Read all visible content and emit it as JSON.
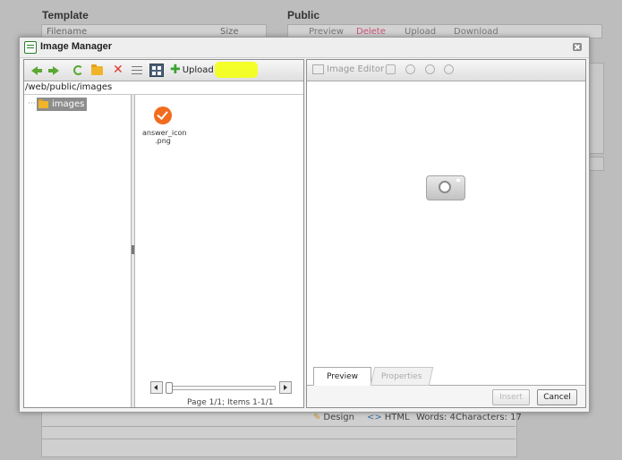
{
  "background": {
    "left_heading": "Template",
    "right_heading": "Public",
    "filename_header": "Filename",
    "size_header": "Size",
    "toolbar_items": [
      "Preview",
      "Delete",
      "Upload",
      "Download"
    ],
    "editor_footer": {
      "design_label": "Design",
      "html_label": "HTML",
      "words": "Words: 4",
      "characters": "Characters: 17"
    }
  },
  "dialog": {
    "title": "Image Manager",
    "left_toolbar": {
      "upload_label": "Upload",
      "highlight_color": "#f3ff1f"
    },
    "path": "/web/public/images",
    "tree": {
      "selected_folder": "images"
    },
    "files": [
      {
        "name": "answer_icon .png",
        "icon": "check-circle-icon",
        "color": "#f26c1f"
      }
    ],
    "page_info": "Page 1/1; Items 1-1/1",
    "right_toolbar": {
      "image_editor_label": "Image Editor"
    },
    "tabs": [
      {
        "label": "Preview",
        "active": true
      },
      {
        "label": "Properties",
        "active": false
      }
    ],
    "buttons": {
      "insert": "Insert",
      "cancel": "Cancel"
    }
  }
}
